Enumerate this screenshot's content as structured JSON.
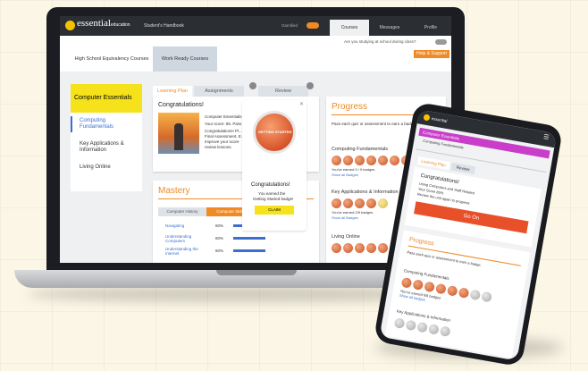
{
  "laptop": {
    "topbar": {
      "brand": "essential",
      "brand_suffix": "education",
      "handbook": "Student's Handbook",
      "toggle_label": "Gamified",
      "tabs": [
        "Courses",
        "Messages",
        "Profile"
      ]
    },
    "subheader": {
      "question": "Are you studying at school during class?",
      "help_button": "Help & Support",
      "course_tabs": [
        "High School Equivalency Courses",
        "Work Ready Courses"
      ]
    },
    "sidebar": {
      "title": "Computer Essentials",
      "items": [
        "Computing Fundamentals",
        "Key Applications & Information",
        "Living Online"
      ]
    },
    "plan_tabs": [
      "Learning Plan",
      "Assignments",
      "Review"
    ],
    "congrats": {
      "title": "Congratulations!",
      "lines": [
        "Computer Essentials",
        "Your score: 85. Pass",
        "Congratulations! Pl...",
        "Final Assessment. E...",
        "Improve your score",
        "review lessons."
      ]
    },
    "mastery": {
      "title": "Mastery",
      "tabs": [
        "Computer History",
        "Computer Skills"
      ],
      "rows": [
        {
          "label": "Navigating",
          "pct": "60%",
          "value": 60
        },
        {
          "label": "Understanding Computers",
          "pct": "60%",
          "value": 60
        },
        {
          "label": "Understanding the Internet",
          "pct": "60%",
          "value": 60
        }
      ]
    },
    "badge_modal": {
      "badge_text": "GETTING STARTED",
      "title": "Congratulations!",
      "line1": "You earned the",
      "line2": "Getting Started badge!",
      "button": "CLAIM"
    },
    "progress": {
      "title": "Progress",
      "intro": "Pass each quiz or assessment to earn a badge.",
      "sections": [
        {
          "title": "Computing Fundamentals",
          "earned": "You've earned 9 / 9 badges",
          "link": "Show all Badges"
        },
        {
          "title": "Key Applications & Information",
          "earned": "You've earned 2/5 badges",
          "link": "Show all Badges"
        },
        {
          "title": "Living Online",
          "earned": "",
          "link": ""
        }
      ]
    }
  },
  "phone": {
    "brand": "essential",
    "nav_items": [
      "Computer Essentials",
      "Computing Fundamentals"
    ],
    "tabs": [
      "Learning Plan",
      "Review"
    ],
    "congrats": {
      "title": "Congratulations!",
      "line1": "Using Computers and Staff Related",
      "line2": "Your Score 85%",
      "line3": "Review the unit again to progress",
      "button": "Go On"
    },
    "progress": {
      "title": "Progress",
      "intro": "Pass each quiz or assessment to earn a badge.",
      "section1": "Computing Fundamentals",
      "section1_earned": "You've earned 6/8 badges",
      "section1_link": "Show all badges",
      "section2": "Key Applications & Information"
    }
  },
  "colors": {
    "accent": "#f08a24",
    "brand_yellow": "#f5c400",
    "badge": "#e0703f",
    "progress_bar": "#3a6fd0"
  }
}
